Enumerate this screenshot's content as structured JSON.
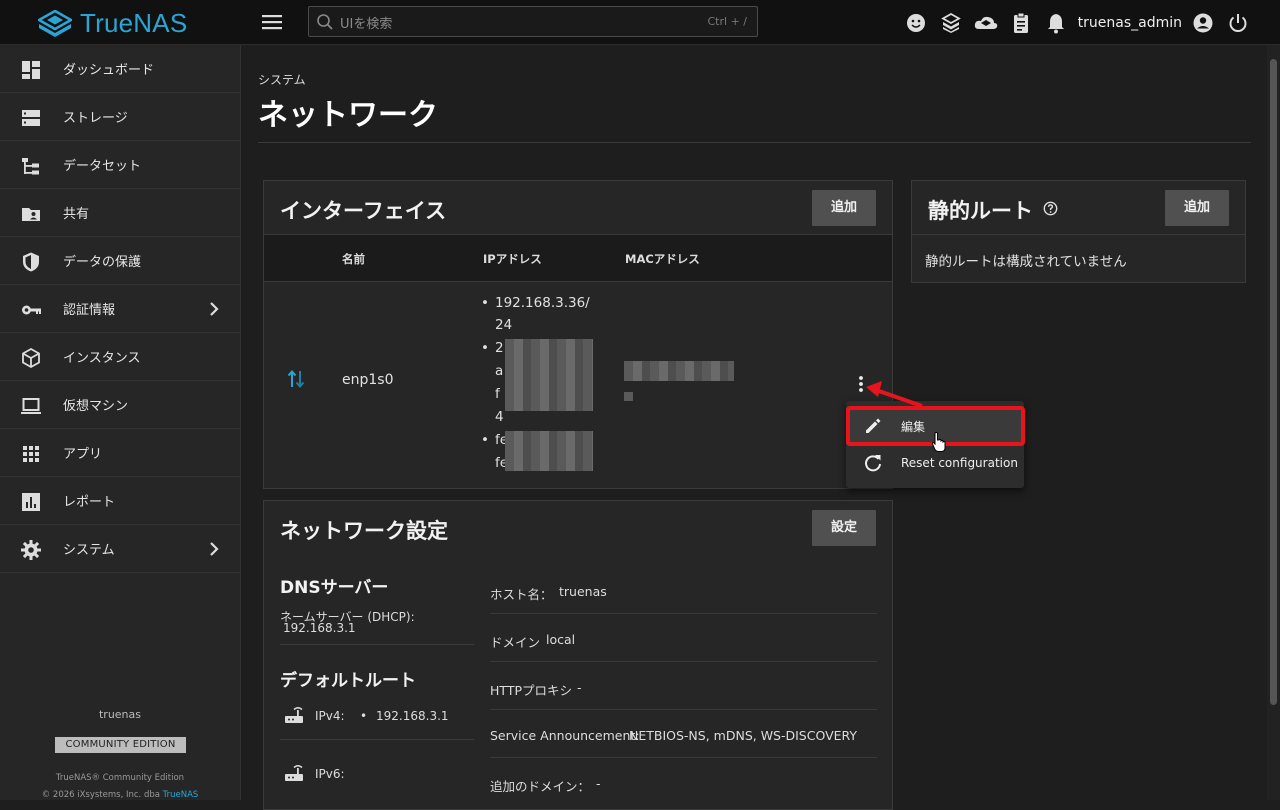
{
  "header": {
    "logo_text": "TrueNAS",
    "search_placeholder": "UIを検索",
    "search_shortcut": "Ctrl + /",
    "username": "truenas_admin"
  },
  "sidebar": {
    "items": [
      {
        "label": "ダッシュボード",
        "icon": "dashboard-icon"
      },
      {
        "label": "ストレージ",
        "icon": "storage-icon"
      },
      {
        "label": "データセット",
        "icon": "datasets-icon"
      },
      {
        "label": "共有",
        "icon": "shares-icon"
      },
      {
        "label": "データの保護",
        "icon": "shield-icon"
      },
      {
        "label": "認証情報",
        "icon": "key-icon",
        "has_children": true
      },
      {
        "label": "インスタンス",
        "icon": "cube-icon"
      },
      {
        "label": "仮想マシン",
        "icon": "laptop-icon"
      },
      {
        "label": "アプリ",
        "icon": "apps-grid-icon"
      },
      {
        "label": "レポート",
        "icon": "chart-icon"
      },
      {
        "label": "システム",
        "icon": "gear-icon",
        "has_children": true
      }
    ],
    "hostname": "truenas",
    "edition_badge": "COMMUNITY EDITION",
    "copyright_line1": "TrueNAS® Community Edition",
    "copyright_line2": "© 2026 iXsystems, Inc. dba",
    "copyright_link": "TrueNAS"
  },
  "page": {
    "breadcrumb": "システム",
    "title": "ネットワーク"
  },
  "interfaces": {
    "title": "インターフェイス",
    "add_label": "追加",
    "columns": [
      "名前",
      "IPアドレス",
      "MACアドレス"
    ],
    "row": {
      "name": "enp1s0",
      "ip_1_line1": "192.168.3.36/",
      "ip_1_line2": "24",
      "ip_2_chars": [
        "2",
        "a",
        "f",
        "4"
      ],
      "ip_3_chars": [
        "fe",
        "fe"
      ]
    },
    "menu": {
      "edit_label": "編集",
      "reset_label": "Reset configuration"
    }
  },
  "static_routes": {
    "title": "静的ルート",
    "add_label": "追加",
    "empty_text": "静的ルートは構成されていません"
  },
  "network_settings": {
    "title": "ネットワーク設定",
    "configure_label": "設定",
    "dns_title": "DNSサーバー",
    "nameserver_label": "ネームサーバー (DHCP):",
    "nameserver_value": "192.168.3.1",
    "default_route_title": "デフォルトルート",
    "ipv4_label": "IPv4:",
    "ipv4_value": "192.168.3.1",
    "ipv6_label": "IPv6:",
    "hostname_label": "ホスト名：",
    "hostname_value": "truenas",
    "domain_label": "ドメイン",
    "domain_value": "local",
    "proxy_label": "HTTPプロキシ",
    "proxy_value": "-",
    "service_label": "Service Announcement:",
    "service_value": "NETBIOS-NS, mDNS, WS-DISCOVERY",
    "extra_domain_label": "追加のドメイン：",
    "extra_domain_value": "-"
  },
  "colors": {
    "brand": "#29a6d6",
    "highlight_red": "#e8141c",
    "background": "#1e1e1e",
    "card": "#262626"
  }
}
